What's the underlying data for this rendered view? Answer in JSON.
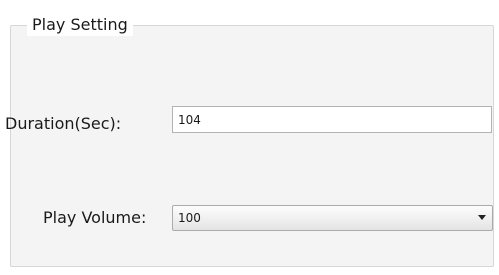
{
  "play_setting": {
    "title": "Play Setting",
    "duration": {
      "label": "Duration(Sec):",
      "value": "104"
    },
    "volume": {
      "label": "Play Volume:",
      "selected": "100",
      "dropdown_icon": "chevron-down-icon"
    }
  }
}
